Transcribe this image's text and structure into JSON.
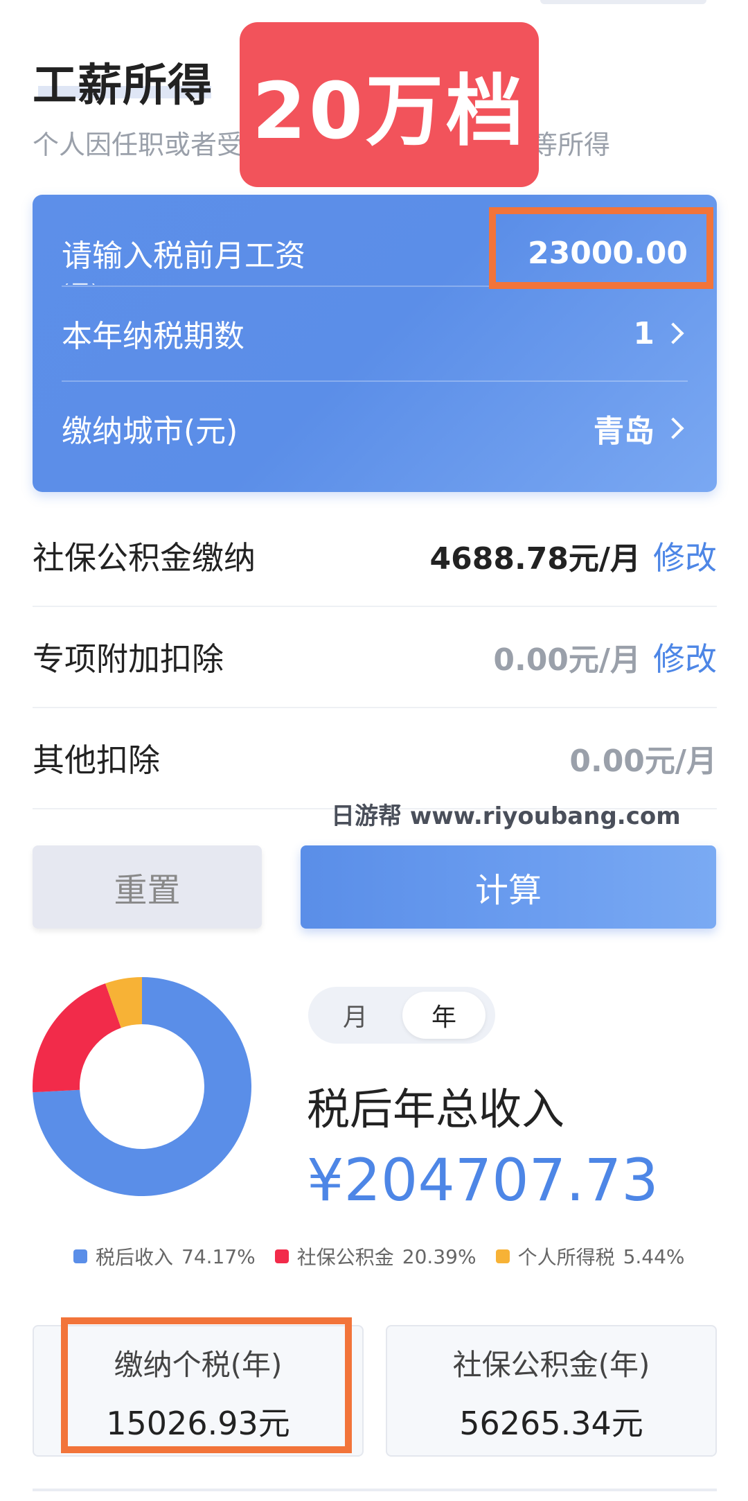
{
  "header": {
    "title": "工薪所得",
    "description_left": "个人因任职或者受",
    "description_right": "等所得",
    "badge": "20万档"
  },
  "form": {
    "salary_label": "请输入税前月工资",
    "salary_label_cut": "(元)",
    "salary_value": "23000.00",
    "period_label": "本年纳税期数",
    "period_value": "1",
    "city_label": "缴纳城市(元)",
    "city_value": "青岛"
  },
  "deductions": {
    "social_label": "社保公积金缴纳",
    "social_value": "4688.78元/月",
    "social_edit": "修改",
    "special_label": "专项附加扣除",
    "special_value": "0.00元/月",
    "special_edit": "修改",
    "other_label": "其他扣除",
    "other_value": "0.00元/月"
  },
  "watermark": "日游帮 www.riyoubang.com",
  "buttons": {
    "reset": "重置",
    "calculate": "计算"
  },
  "result": {
    "toggle_month": "月",
    "toggle_year": "年",
    "toggle_selected": "年",
    "income_label": "税后年总收入",
    "income_value": "¥204707.73",
    "tax_label": "缴纳个税(年)",
    "tax_value": "15026.93元",
    "social_label": "社保公积金(年)",
    "social_value": "56265.34元"
  },
  "chart_data": {
    "type": "pie",
    "style": "donut",
    "legend_position": "bottom",
    "slices": [
      {
        "name": "税后收入",
        "percent_label": "74.17%",
        "value": 74.17,
        "color": "#5a8ee8"
      },
      {
        "name": "社保公积金",
        "percent_label": "20.39%",
        "value": 20.39,
        "color": "#f22b4a"
      },
      {
        "name": "个人所得税",
        "percent_label": "5.44%",
        "value": 5.44,
        "color": "#f7b236"
      }
    ]
  },
  "colors": {
    "accent_blue": "#4d86e6",
    "badge_red": "#f2535b",
    "highlight_orange": "#f2743a"
  }
}
